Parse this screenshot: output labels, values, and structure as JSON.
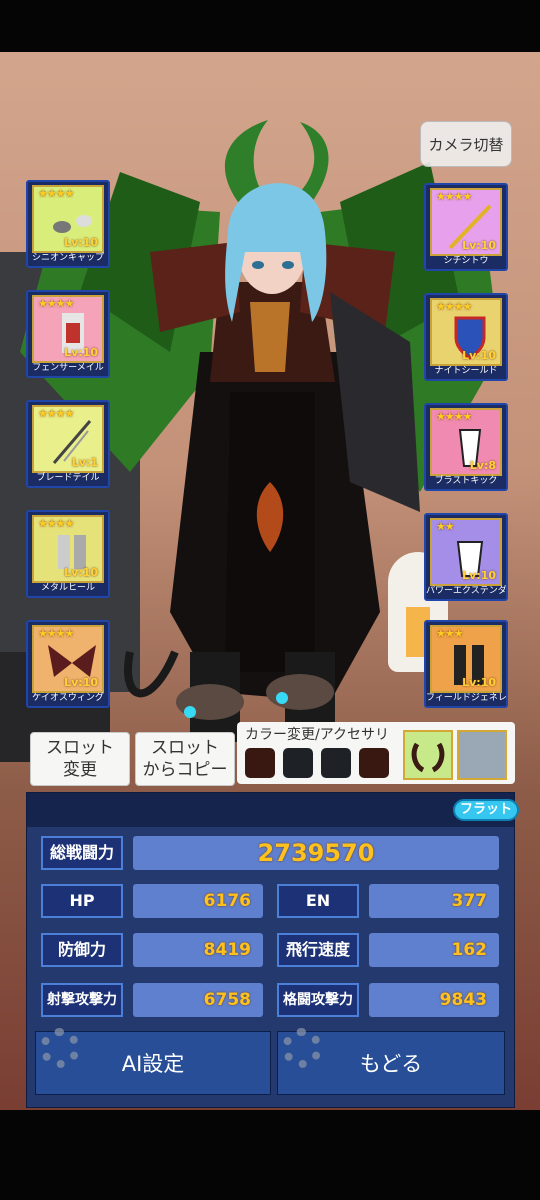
{
  "header": {
    "camera_button_label": "カメラ切替"
  },
  "equipment_left": [
    {
      "name": "シニオンキャップ",
      "level": "Lv:10",
      "stars": "★★★★",
      "icon": "cap-icon",
      "bg": "#d9ee7a"
    },
    {
      "name": "フェンサーメイル",
      "level": "Lv:10",
      "stars": "★★★★",
      "icon": "armor-icon",
      "bg": "#f4a3b8"
    },
    {
      "name": "ブレードテイル",
      "level": "Lv:1",
      "stars": "★★★★",
      "icon": "blade-tail-icon",
      "bg": "#e9ef8a"
    },
    {
      "name": "メタルヒール",
      "level": "Lv:10",
      "stars": "★★★★",
      "icon": "metal-heel-icon",
      "bg": "#e6e27a"
    },
    {
      "name": "ケイオスウィング",
      "level": "Lv:10",
      "stars": "★★★★",
      "icon": "chaos-wing-icon",
      "bg": "#efb36d"
    }
  ],
  "equipment_right": [
    {
      "name": "シチシトウ",
      "level": "Lv:10",
      "stars": "★★★★",
      "icon": "sword-icon",
      "bg": "#e7a1ec"
    },
    {
      "name": "ナイトシールド",
      "level": "Lv:10",
      "stars": "★★★★",
      "icon": "shield-icon",
      "bg": "#e9d36f"
    },
    {
      "name": "ブラストキック",
      "level": "Lv:8",
      "stars": "★★★★",
      "icon": "blast-kick-icon",
      "bg": "#f08ab0"
    },
    {
      "name": "パワーエクステンダー",
      "level": "Lv:10",
      "stars": "★★",
      "icon": "power-extender-icon",
      "bg": "#a48ee8"
    },
    {
      "name": "フィールドジェネレーター",
      "level": "Lv:10",
      "stars": "★★★",
      "icon": "field-generator-icon",
      "bg": "#f0a24a"
    }
  ],
  "slots": {
    "change_label": "スロット\n変更",
    "copy_label": "スロット\nからコピー"
  },
  "color_panel": {
    "title": "カラー変更/アクセサリ",
    "swatches": [
      "#3a1812",
      "#1e2126",
      "#1e2126",
      "#3a1812"
    ]
  },
  "stats": {
    "badge": "フラット",
    "total_label": "総戦闘力",
    "total_value": "2739570",
    "rows": [
      {
        "left_label": "HP",
        "left_value": "6176",
        "right_label": "EN",
        "right_value": "377"
      },
      {
        "left_label": "防御力",
        "left_value": "8419",
        "right_label": "飛行速度",
        "right_value": "162"
      },
      {
        "left_label": "射撃攻撃力",
        "left_value": "6758",
        "right_label": "格闘攻撃力",
        "right_value": "9843"
      }
    ]
  },
  "actions": {
    "ai_label": "AI設定",
    "back_label": "もどる"
  },
  "colors": {
    "accent": "#35c7f0",
    "stat_value": "#ffc11e",
    "panel": "#243a6e"
  }
}
